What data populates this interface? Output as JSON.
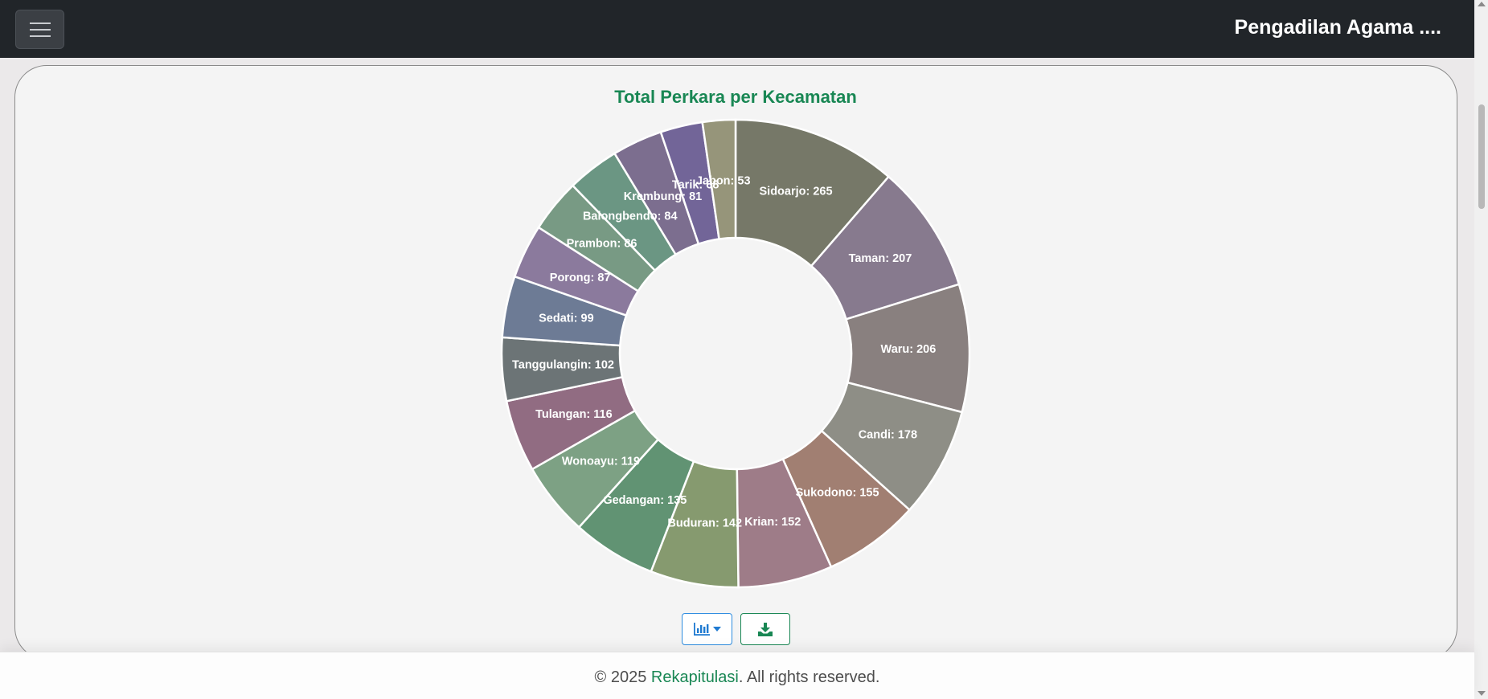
{
  "navbar": {
    "brand": "Pengadilan Agama ...."
  },
  "chart_data": {
    "type": "pie",
    "title": "Total Perkara per Kecamatan",
    "donut": true,
    "start": "top, clockwise",
    "categories": [
      "Sidoarjo",
      "Taman",
      "Waru",
      "Candi",
      "Sukodono",
      "Krian",
      "Buduran",
      "Gedangan",
      "Wonoayu",
      "Tulangan",
      "Tanggulangin",
      "Sedati",
      "Porong",
      "Prambon",
      "Balongbendo",
      "Krembung",
      "Tarik",
      "Jabon"
    ],
    "values": [
      265,
      207,
      206,
      178,
      155,
      152,
      142,
      135,
      119,
      116,
      102,
      99,
      87,
      86,
      84,
      81,
      68,
      53
    ],
    "colors": [
      "#767868",
      "#877a8e",
      "#89807f",
      "#8e8e86",
      "#a17f72",
      "#9e7c88",
      "#869a6f",
      "#619373",
      "#7da184",
      "#916c82",
      "#6c7476",
      "#6d7b95",
      "#8b7a9d",
      "#789a84",
      "#6b9683",
      "#7c6e8f",
      "#726598",
      "#96957a"
    ],
    "data_labels": [
      "Sidoarjo: 265",
      "Taman: 207",
      "Waru: 206",
      "Candi: 178",
      "Sukodono: 155",
      "Krian: 152",
      "Buduran: 142",
      "Gedangan: 135",
      "Wonoayu: 119",
      "Tulangan: 116",
      "Tanggulangin: 102",
      "Sedati: 99",
      "Porong: 87",
      "Prambon: 86",
      "Balongbendo: 84",
      "Krembung: 81",
      "Tarik: 68",
      "Jabon: 53"
    ]
  },
  "toolbar": {
    "chart_type_icon": "bar-chart-icon",
    "dropdown_icon": "caret-down-icon",
    "download_icon": "download-icon"
  },
  "footer": {
    "prefix": "© 2025 ",
    "link": "Rekapitulasi",
    "suffix": ". All rights reserved."
  },
  "colors": {
    "navbar": "#212529",
    "accent": "#198754",
    "chart_button_border": "#2d8ce0"
  }
}
